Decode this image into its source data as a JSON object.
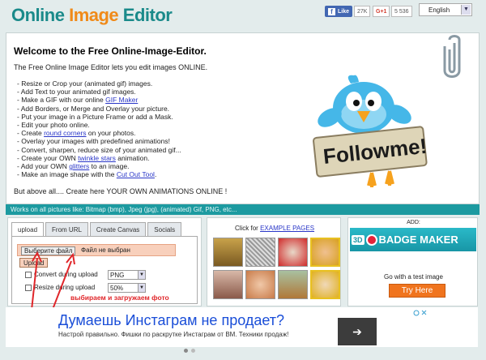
{
  "header": {
    "logo_word1": "Online",
    "logo_word2": "Image",
    "logo_word3": "Editor",
    "fb_like": "Like",
    "fb_count": "27K",
    "gplus": "G+1",
    "gplus_count": "5 536",
    "language": "English"
  },
  "welcome": {
    "title": "Welcome to the Free Online-Image-Editor.",
    "intro": "The Free Online Image Editor lets you edit images ONLINE.",
    "items": [
      {
        "pre": "- Resize or Crop your (animated gif) images.",
        "link": "",
        "post": ""
      },
      {
        "pre": "- Add Text to your animated gif images.",
        "link": "",
        "post": ""
      },
      {
        "pre": "- Make a GIF with our online ",
        "link": "GIF Maker",
        "post": ""
      },
      {
        "pre": "- Add Borders, or Merge and Overlay your picture.",
        "link": "",
        "post": ""
      },
      {
        "pre": "- Put your image in a Picture Frame or add a Mask.",
        "link": "",
        "post": ""
      },
      {
        "pre": "- Edit your photo online.",
        "link": "",
        "post": ""
      },
      {
        "pre": "- Create ",
        "link": "round corners",
        "post": " on your photos."
      },
      {
        "pre": "- Overlay your images with predefined animations!",
        "link": "",
        "post": ""
      },
      {
        "pre": "- Convert, sharpen, reduce size of your animated gif...",
        "link": "",
        "post": ""
      },
      {
        "pre": "- Create your OWN ",
        "link": "twinkle stars",
        "post": " animation."
      },
      {
        "pre": "- Add your OWN ",
        "link": "glitters",
        "post": " to an image."
      },
      {
        "pre": "- Make an image shape with the ",
        "link": "Cut Out Tool",
        "post": "."
      }
    ],
    "ending": "But above all.... Create here YOUR OWN ANIMATIONS ONLINE !",
    "bird_sign": "Followme!"
  },
  "strip": "Works on all pictures like: Bitmap (bmp), Jpeg (jpg), (animated) Gif, PNG, etc...",
  "upload": {
    "tabs": [
      "upload",
      "From URL",
      "Create Canvas",
      "Socials"
    ],
    "choose_file": "Выберите файл",
    "no_file": "Файл не выбран",
    "upload_button": "Upload",
    "convert_label": "Convert during upload",
    "convert_value": "PNG",
    "resize_label": "Resize during upload",
    "resize_value": "50%",
    "annotation": "выбираем и загружаем фото"
  },
  "examples": {
    "pre": "Click for ",
    "link": "EXAMPLE PAGES"
  },
  "badge": {
    "ad_label": "ADD:",
    "banner_3d": "3D",
    "banner_text": "BADGE MAKER",
    "test_text": "Go with a test image",
    "try_button": "Try Here"
  },
  "ad": {
    "title": "Думаешь Инстаграм не продает?",
    "text": "Настрой правильно. Фишки по раскрутке Инстаграм от ВМ. Техники продаж!",
    "go": "➔"
  }
}
